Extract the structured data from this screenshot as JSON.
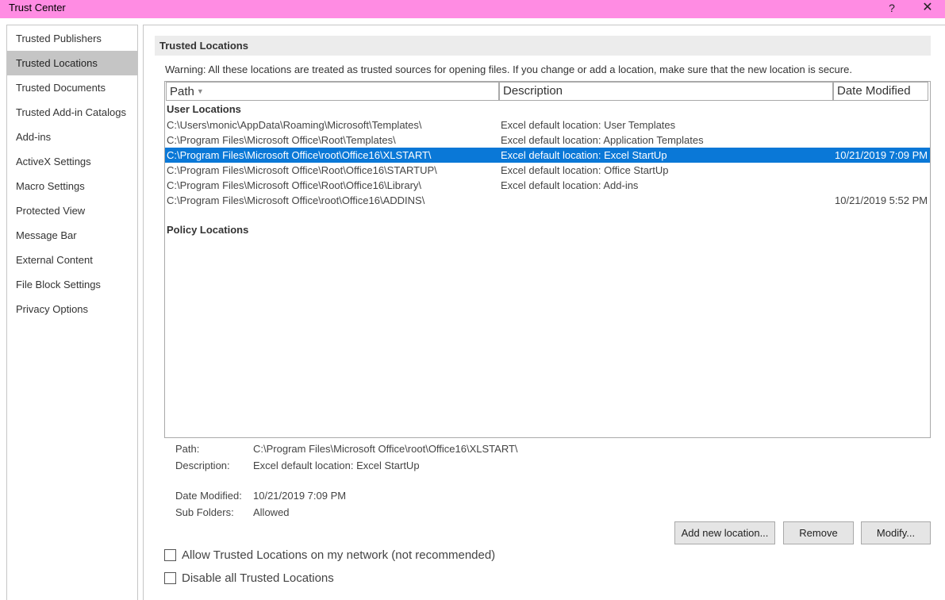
{
  "window": {
    "title": "Trust Center",
    "help": "?",
    "close": "✕"
  },
  "sidebar": {
    "items": [
      {
        "label": "Trusted Publishers",
        "selected": false
      },
      {
        "label": "Trusted Locations",
        "selected": true
      },
      {
        "label": "Trusted Documents",
        "selected": false
      },
      {
        "label": "Trusted Add-in Catalogs",
        "selected": false
      },
      {
        "label": "Add-ins",
        "selected": false
      },
      {
        "label": "ActiveX Settings",
        "selected": false
      },
      {
        "label": "Macro Settings",
        "selected": false
      },
      {
        "label": "Protected View",
        "selected": false
      },
      {
        "label": "Message Bar",
        "selected": false
      },
      {
        "label": "External Content",
        "selected": false
      },
      {
        "label": "File Block Settings",
        "selected": false
      },
      {
        "label": "Privacy Options",
        "selected": false
      }
    ]
  },
  "main": {
    "header": "Trusted Locations",
    "warning": "Warning: All these locations are treated as trusted sources for opening files.  If you change or add a location, make sure that the new location is secure.",
    "columns": {
      "path": "Path",
      "description": "Description",
      "date_modified": "Date Modified"
    },
    "user_locations_label": "User Locations",
    "rows": [
      {
        "path": "C:\\Users\\monic\\AppData\\Roaming\\Microsoft\\Templates\\",
        "description": "Excel default location: User Templates",
        "date": ""
      },
      {
        "path": "C:\\Program Files\\Microsoft Office\\Root\\Templates\\",
        "description": "Excel default location: Application Templates",
        "date": ""
      },
      {
        "path": "C:\\Program Files\\Microsoft Office\\root\\Office16\\XLSTART\\",
        "description": "Excel default location: Excel StartUp",
        "date": "10/21/2019 7:09 PM"
      },
      {
        "path": "C:\\Program Files\\Microsoft Office\\Root\\Office16\\STARTUP\\",
        "description": "Excel default location: Office StartUp",
        "date": ""
      },
      {
        "path": "C:\\Program Files\\Microsoft Office\\Root\\Office16\\Library\\",
        "description": "Excel default location: Add-ins",
        "date": ""
      },
      {
        "path": "C:\\Program Files\\Microsoft Office\\root\\Office16\\ADDINS\\",
        "description": "",
        "date": "10/21/2019 5:52 PM"
      }
    ],
    "selected_row": 2,
    "policy_locations_label": "Policy Locations",
    "details": {
      "path_label": "Path:",
      "path_value": "C:\\Program Files\\Microsoft Office\\root\\Office16\\XLSTART\\",
      "description_label": "Description:",
      "description_value": "Excel default location: Excel StartUp",
      "date_label": "Date Modified:",
      "date_value": "10/21/2019 7:09 PM",
      "subfolders_label": "Sub Folders:",
      "subfolders_value": "Allowed"
    },
    "buttons": {
      "add": "Add new location...",
      "remove": "Remove",
      "modify": "Modify..."
    },
    "checkboxes": {
      "allow_network": "Allow Trusted Locations on my network (not recommended)",
      "allow_network_checked": false,
      "disable_all": "Disable all Trusted Locations",
      "disable_all_checked": false
    }
  },
  "colors": {
    "titlebar": "#ff8ce3",
    "selection": "#0a78d7",
    "sidebar_selected": "#c5c5c5"
  }
}
